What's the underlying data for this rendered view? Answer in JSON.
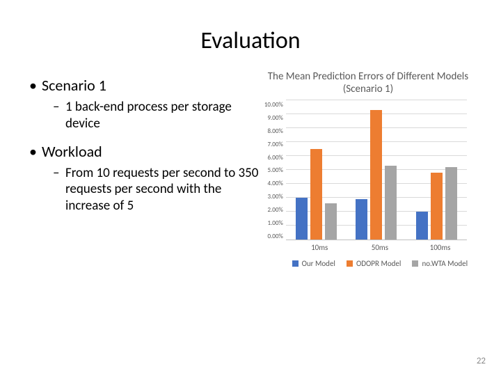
{
  "title": "Evaluation",
  "bullets": {
    "b1": "Scenario 1",
    "b1_sub": "1 back-end process per storage device",
    "b2": "Workload",
    "b2_sub": "From 10 requests per second to 350 requests per second with the increase of 5"
  },
  "page_number": "22",
  "chart_data": {
    "type": "bar",
    "title": "The Mean Prediction Errors of Different Models (Scenario 1)",
    "xlabel": "",
    "ylabel": "",
    "ylim": [
      0,
      10
    ],
    "y_ticks": [
      "0.00%",
      "1.00%",
      "2.00%",
      "3.00%",
      "4.00%",
      "5.00%",
      "6.00%",
      "7.00%",
      "8.00%",
      "9.00%",
      "10.00%"
    ],
    "categories": [
      "10ms",
      "50ms",
      "100ms"
    ],
    "series": [
      {
        "name": "Our Model",
        "color": "#4472c4",
        "values": [
          3.0,
          2.9,
          2.0
        ]
      },
      {
        "name": "ODOPR Model",
        "color": "#ed7d31",
        "values": [
          6.5,
          9.3,
          4.8
        ]
      },
      {
        "name": "no.WTA Model",
        "color": "#a5a5a5",
        "values": [
          2.6,
          5.3,
          5.2
        ]
      }
    ],
    "legend_position": "bottom"
  }
}
